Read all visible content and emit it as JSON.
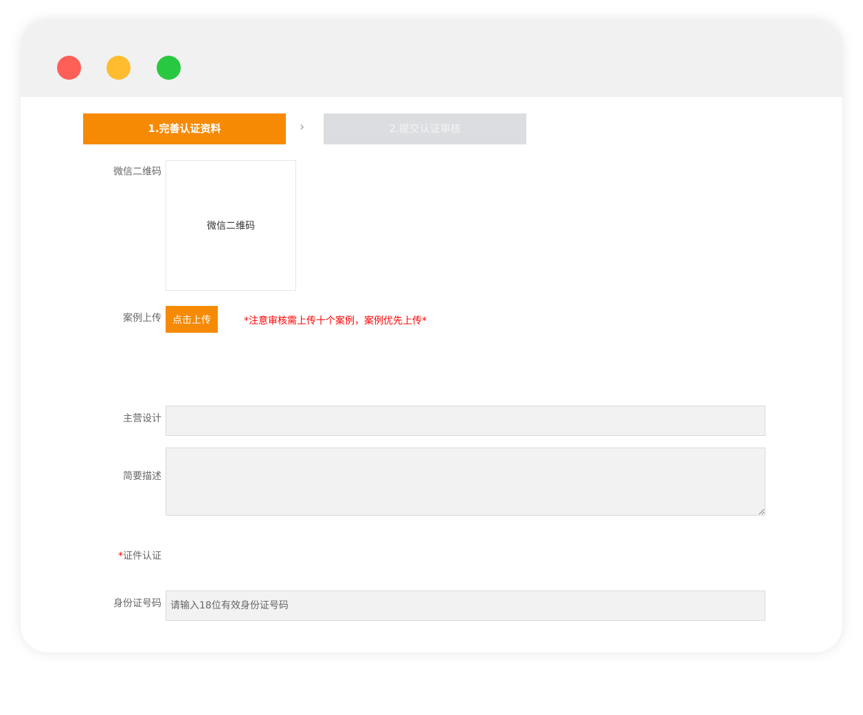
{
  "window": {
    "controls": {
      "close_color": "#fe5f57",
      "minimize_color": "#febc2e",
      "maximize_color": "#28c840"
    }
  },
  "steps": {
    "step1": "1.完善认证资料",
    "arrow": "›",
    "step2": "2.提交认证审核"
  },
  "form": {
    "wechat_qr": {
      "label": "微信二维码",
      "box_text": "微信二维码"
    },
    "case_upload": {
      "label": "案例上传",
      "button": "点击上传",
      "notice": "*注意审核需上传十个案例，案例优先上传*"
    },
    "main_design": {
      "label": "主营设计",
      "value": ""
    },
    "description": {
      "label": "简要描述",
      "value": ""
    },
    "certificate": {
      "required_mark": "*",
      "label": "证件认证"
    },
    "id_number": {
      "label": "身份证号码",
      "placeholder": "请输入18位有效身份证号码"
    }
  },
  "colors": {
    "accent": "#f68a04",
    "inactive_step": "#dcdde0",
    "notice": "#ff0000"
  }
}
